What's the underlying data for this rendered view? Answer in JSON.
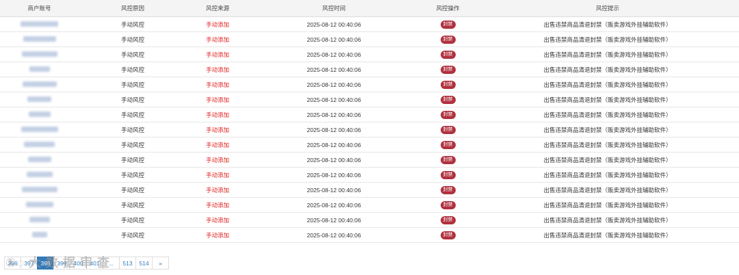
{
  "table": {
    "headers": [
      "商户账号",
      "风控原因",
      "风控来源",
      "风控时间",
      "风控操作",
      "风控提示"
    ],
    "rows": [
      {
        "reason": "手动风控",
        "source": "手动添加",
        "time": "2025-08-12 00:40:06",
        "action": "封禁",
        "tip": "出售违禁商品清退封禁（贩卖游戏外挂辅助软件）"
      },
      {
        "reason": "手动风控",
        "source": "手动添加",
        "time": "2025-08-12 00:40:06",
        "action": "封禁",
        "tip": "出售违禁商品清退封禁（贩卖游戏外挂辅助软件）"
      },
      {
        "reason": "手动风控",
        "source": "手动添加",
        "time": "2025-08-12 00:40:06",
        "action": "封禁",
        "tip": "出售违禁商品清退封禁（贩卖游戏外挂辅助软件）"
      },
      {
        "reason": "手动风控",
        "source": "手动添加",
        "time": "2025-08-12 00:40:06",
        "action": "封禁",
        "tip": "出售违禁商品清退封禁（贩卖游戏外挂辅助软件）"
      },
      {
        "reason": "手动风控",
        "source": "手动添加",
        "time": "2025-08-12 00:40:06",
        "action": "封禁",
        "tip": "出售违禁商品清退封禁（贩卖游戏外挂辅助软件）"
      },
      {
        "reason": "手动风控",
        "source": "手动添加",
        "time": "2025-08-12 00:40:06",
        "action": "封禁",
        "tip": "出售违禁商品清退封禁（贩卖游戏外挂辅助软件）"
      },
      {
        "reason": "手动风控",
        "source": "手动添加",
        "time": "2025-08-12 00:40:06",
        "action": "封禁",
        "tip": "出售违禁商品清退封禁（贩卖游戏外挂辅助软件）"
      },
      {
        "reason": "手动风控",
        "source": "手动添加",
        "time": "2025-08-12 00:40:06",
        "action": "封禁",
        "tip": "出售违禁商品清退封禁（贩卖游戏外挂辅助软件）"
      },
      {
        "reason": "手动风控",
        "source": "手动添加",
        "time": "2025-08-12 00:40:06",
        "action": "封禁",
        "tip": "出售违禁商品清退封禁（贩卖游戏外挂辅助软件）"
      },
      {
        "reason": "手动风控",
        "source": "手动添加",
        "time": "2025-08-12 00:40:06",
        "action": "封禁",
        "tip": "出售违禁商品清退封禁（贩卖游戏外挂辅助软件）"
      },
      {
        "reason": "手动风控",
        "source": "手动添加",
        "time": "2025-08-12 00:40:06",
        "action": "封禁",
        "tip": "出售违禁商品清退封禁（贩卖游戏外挂辅助软件）"
      },
      {
        "reason": "手动风控",
        "source": "手动添加",
        "time": "2025-08-12 00:40:06",
        "action": "封禁",
        "tip": "出售违禁商品清退封禁（贩卖游戏外挂辅助软件）"
      },
      {
        "reason": "手动风控",
        "source": "手动添加",
        "time": "2025-08-12 00:40:06",
        "action": "封禁",
        "tip": "出售违禁商品清退封禁（贩卖游戏外挂辅助软件）"
      },
      {
        "reason": "手动风控",
        "source": "手动添加",
        "time": "2025-08-12 00:40:06",
        "action": "封禁",
        "tip": "出售违禁商品清退封禁（贩卖游戏外挂辅助软件）"
      },
      {
        "reason": "手动风控",
        "source": "手动添加",
        "time": "2025-08-12 00:40:06",
        "action": "封禁",
        "tip": "出售违禁商品清退封禁（贩卖游戏外挂辅助软件）"
      }
    ]
  },
  "pagination": {
    "pages": [
      "396",
      "397",
      "398",
      "399",
      "400",
      "401",
      "...",
      "513",
      "514",
      "»"
    ],
    "active_index": 2
  },
  "colors": {
    "source_text": "#e02020",
    "ban_badge": "#b0313e",
    "active_page": "#337ab7"
  }
}
